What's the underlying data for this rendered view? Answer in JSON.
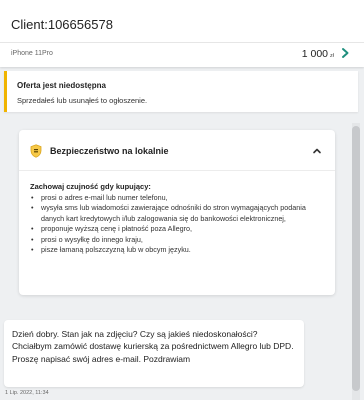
{
  "header": {
    "client_title": "Client:106656578",
    "product_name": "iPhone 11Pro",
    "price_value": "1 000",
    "price_currency": "zł",
    "arrow_icon": "chevron-right-icon",
    "accent_color": "#1f8f7e"
  },
  "alert": {
    "title": "Oferta jest niedostępna",
    "text": "Sprzedałeś lub usunąłeś to ogłoszenie.",
    "accent_color": "#f0b400"
  },
  "safety": {
    "icon": "shield-icon",
    "title": "Bezpieczeństwo na lokalnie",
    "toggle_icon": "chevron-up-icon",
    "lead": "Zachowaj czujność gdy kupujący:",
    "items": [
      "prosi o adres e-mail lub numer telefonu,",
      "wysyła sms lub wiadomości zawierające odnośniki do stron wymagających podania danych kart kredytowych i/lub zalogowania się do bankowości elektronicznej,",
      "proponuje wyższą cenę i płatność poza Allegro,",
      "prosi o wysyłkę do innego kraju,",
      "pisze łamaną polszczyzną lub w obcym języku."
    ]
  },
  "message": {
    "text": "Dzień dobry. Stan jak na zdjęciu? Czy są jakieś niedoskonałości? Chciałbym zamówić dostawę kurierską za pośrednictwem Allegro lub DPD. Proszę napisać swój adres e-mail. Pozdrawiam",
    "timestamp": "1 Lip. 2022, 11:34"
  }
}
